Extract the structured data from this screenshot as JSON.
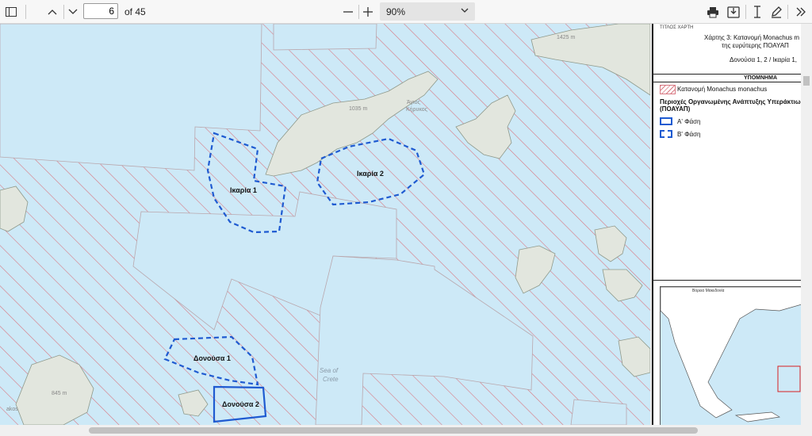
{
  "toolbar": {
    "page_current": "6",
    "page_total": "of 45",
    "zoom": "90%",
    "icons": [
      "sidebar-icon",
      "chevron-up-icon",
      "chevron-down-icon",
      "minus-icon",
      "plus-icon",
      "print-icon",
      "save-icon",
      "text-cursor-icon",
      "pen-icon",
      "double-chevron-right-icon"
    ]
  },
  "map": {
    "area_labels": [
      "Ικαρία 1",
      "Ικαρία 2",
      "Δονούσα 1",
      "Δονούσα 2"
    ],
    "sea_label_1": "Sea of",
    "sea_label_2": "Crete",
    "peak_ikaria": "1035 m",
    "place_agios": "Άγιος",
    "place_kirykos": "Κήρυκος",
    "peak_ne": "1425 m",
    "peak_sw": "845 m",
    "place_sw": "akos",
    "colors": {
      "sea": "#cde9f7",
      "hatch": "#d97a84",
      "land": "#e2e6de",
      "boundary": "#1f5bd1"
    }
  },
  "panel": {
    "title_header": "ΤΙΤΛΟΣ ΧΑΡΤΗ",
    "title_line1": "Χάρτης 3: Κατανομή Monachus m",
    "title_line2": "της ευρύτερης ΠΟΑΥΑΠ",
    "title_line3": "Δονούσα 1, 2 / Ικαρία 1,",
    "legend_header": "ΥΠΟΜΝΗΜΑ",
    "legend_distribution": "Κατανομή Monachus monachus",
    "legend_group_title_1": "Περιοχές Οργανωμένης Ανάπτυξης Υπεράκτιω",
    "legend_group_title_2": "(ΠΟΑΥΑΠ)",
    "legend_phase_a": "Α' Φάση",
    "legend_phase_b": "Β' Φάση",
    "inset_label": "Βόρεια Μακεδονία"
  }
}
